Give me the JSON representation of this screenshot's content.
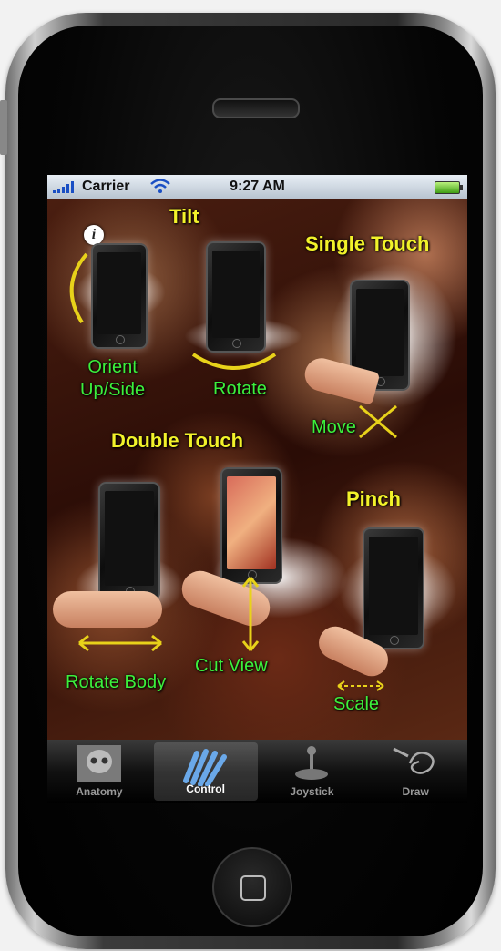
{
  "status_bar": {
    "carrier": "Carrier",
    "time": "9:27 AM"
  },
  "headings": {
    "tilt": "Tilt",
    "single_touch": "Single Touch",
    "double_touch": "Double Touch",
    "pinch": "Pinch"
  },
  "gestures": {
    "orient": "Orient\nUp/Side",
    "rotate": "Rotate",
    "move": "Move",
    "rotate_body": "Rotate Body",
    "cut_view": "Cut View",
    "scale": "Scale"
  },
  "tabs": [
    {
      "label": "Anatomy",
      "icon": "skull-icon"
    },
    {
      "label": "Control",
      "icon": "hand-icon"
    },
    {
      "label": "Joystick",
      "icon": "joystick-icon"
    },
    {
      "label": "Draw",
      "icon": "draw-icon"
    }
  ],
  "active_tab": "Control",
  "colors": {
    "heading": "#f2f22a",
    "label": "#3cf03c"
  }
}
